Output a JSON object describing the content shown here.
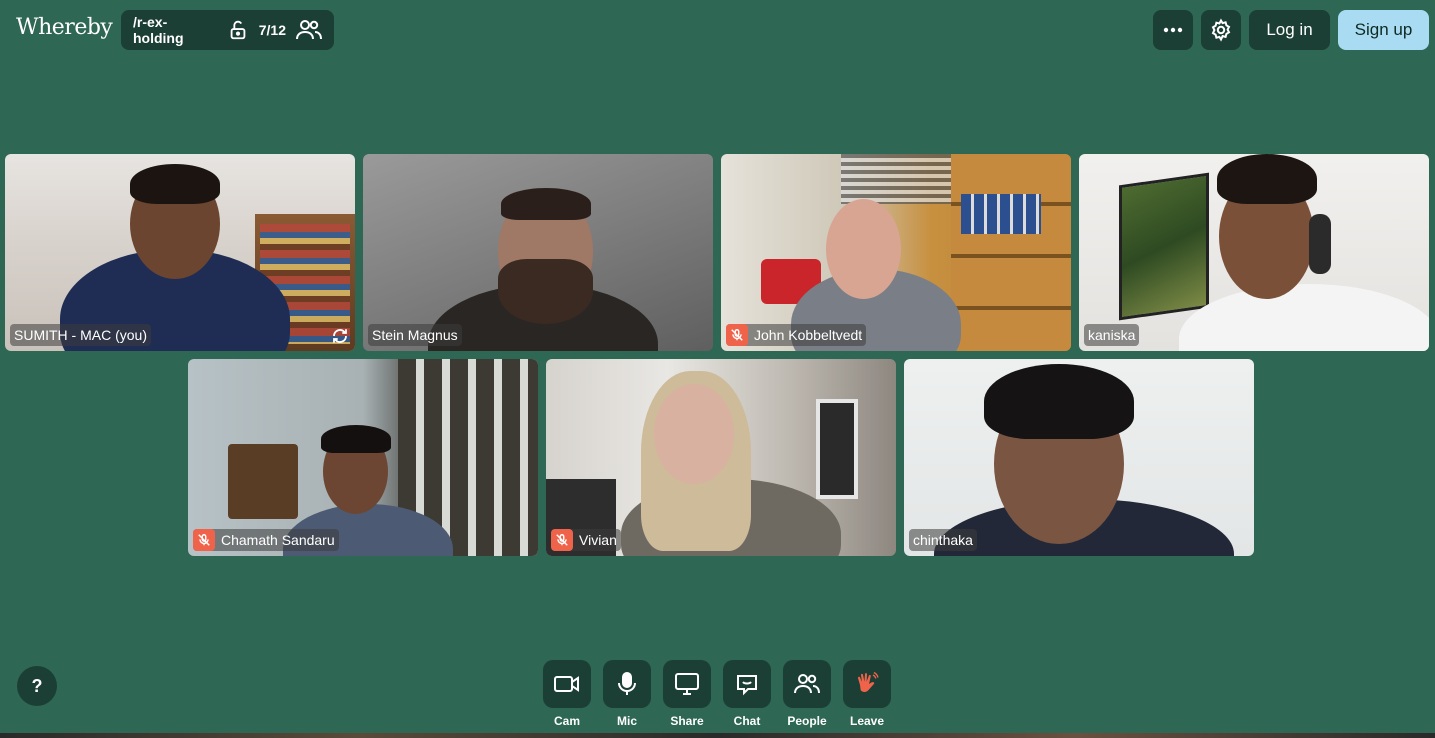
{
  "app": {
    "logo": "Whereby",
    "room_name": "/r-ex-holding",
    "participant_count": "7/12"
  },
  "header": {
    "login_label": "Log in",
    "signup_label": "Sign up",
    "signup_color": "#a9dcf2"
  },
  "participants": [
    {
      "name": "SUMITH - MAC (you)",
      "muted": false
    },
    {
      "name": "Stein Magnus",
      "muted": false
    },
    {
      "name": "John Kobbeltvedt",
      "muted": true
    },
    {
      "name": "kaniska",
      "muted": false
    },
    {
      "name": "Chamath Sandaru",
      "muted": true
    },
    {
      "name": "Vivian",
      "muted": true
    },
    {
      "name": "chinthaka",
      "muted": false
    }
  ],
  "controls": {
    "cam": "Cam",
    "mic": "Mic",
    "share": "Share",
    "chat": "Chat",
    "people": "People",
    "leave": "Leave"
  },
  "help_label": "?",
  "colors": {
    "background": "#2e6753",
    "panel": "#1c3f35",
    "mute": "#f0634b"
  },
  "icons": [
    "lock-open-icon",
    "people-icon",
    "more-icon",
    "gear-icon",
    "mic-off-icon",
    "sync-icon",
    "camera-icon",
    "mic-icon",
    "screen-share-icon",
    "chat-icon",
    "leave-hand-icon"
  ]
}
